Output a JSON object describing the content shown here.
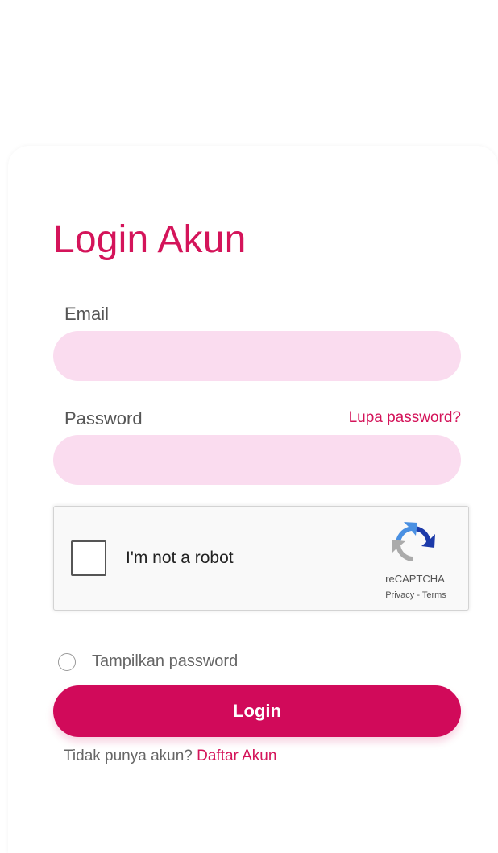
{
  "login": {
    "title": "Login Akun",
    "email_label": "Email",
    "email_value": "",
    "password_label": "Password",
    "password_value": "",
    "forgot_link": "Lupa password?",
    "show_password_label": "Tampilkan password",
    "login_button": "Login",
    "signup_prompt": "Tidak punya akun?",
    "signup_link": "Daftar Akun"
  },
  "recaptcha": {
    "label": "I'm not a robot",
    "brand": "reCAPTCHA",
    "privacy": "Privacy",
    "separator": " - ",
    "terms": "Terms",
    "logo_icon": "recaptcha-logo-icon"
  },
  "colors": {
    "accent": "#d4145a",
    "button": "#d10a5a",
    "input_bg": "#fadcef"
  }
}
